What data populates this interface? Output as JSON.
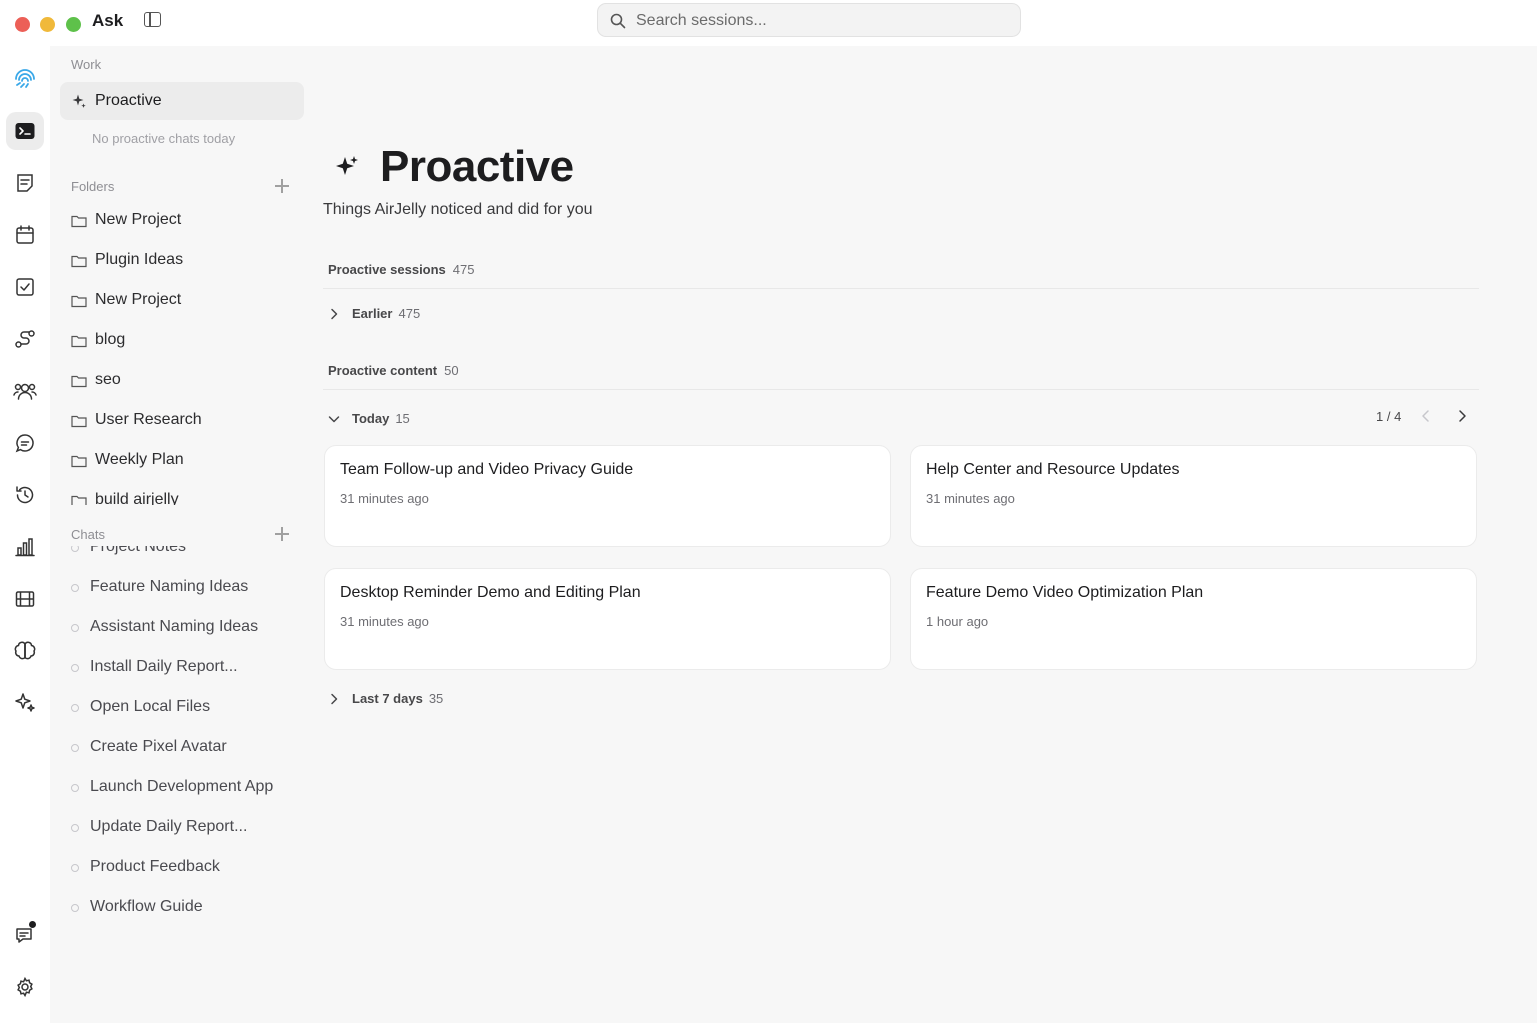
{
  "app": {
    "title": "Ask"
  },
  "search": {
    "placeholder": "Search sessions..."
  },
  "rail": {
    "icons": [
      "fingerprint-icon",
      "terminal-icon",
      "notes-icon",
      "calendar-icon",
      "checkbox-icon",
      "route-icon",
      "people-icon",
      "chat-bubble-icon",
      "history-icon",
      "bar-chart-icon",
      "film-icon",
      "brain-icon",
      "sparkle-icon",
      "feedback-icon",
      "gear-icon"
    ],
    "active": "terminal-icon"
  },
  "sidebar": {
    "work_label": "Work",
    "proactive_label": "Proactive",
    "empty_note": "No proactive chats today",
    "folders_label": "Folders",
    "folders": [
      "New Project",
      "Plugin Ideas",
      "New Project",
      "blog",
      "seo",
      "User Research",
      "Weekly Plan",
      "build airjelly"
    ],
    "chats_label": "Chats",
    "chats": [
      "Project Notes",
      "Feature Naming Ideas",
      "Assistant Naming Ideas",
      "Install Daily Report...",
      "Open Local Files",
      "Create Pixel Avatar",
      "Launch Development App",
      "Update Daily Report...",
      "Product Feedback",
      "Workflow Guide"
    ]
  },
  "main": {
    "title": "Proactive",
    "subtitle": "Things AirJelly noticed and did for you",
    "sessions": {
      "label": "Proactive sessions",
      "count": "475"
    },
    "earlier": {
      "label": "Earlier",
      "count": "475"
    },
    "content": {
      "label": "Proactive content",
      "count": "50"
    },
    "today": {
      "label": "Today",
      "count": "15"
    },
    "pager": "1 / 4",
    "cards": [
      {
        "title": "Team Follow-up and Video Privacy Guide",
        "time": "31 minutes ago"
      },
      {
        "title": "Help Center and Resource Updates",
        "time": "31 minutes ago"
      },
      {
        "title": "Desktop Reminder Demo and Editing Plan",
        "time": "31 minutes ago"
      },
      {
        "title": "Feature Demo Video Optimization Plan",
        "time": "1 hour ago"
      }
    ],
    "last7": {
      "label": "Last 7 days",
      "count": "35"
    }
  },
  "colors": {
    "red": "#ec5f57",
    "yellow": "#f0b93a",
    "green": "#5ec14a",
    "accent_blue": "#3aa8e8"
  }
}
